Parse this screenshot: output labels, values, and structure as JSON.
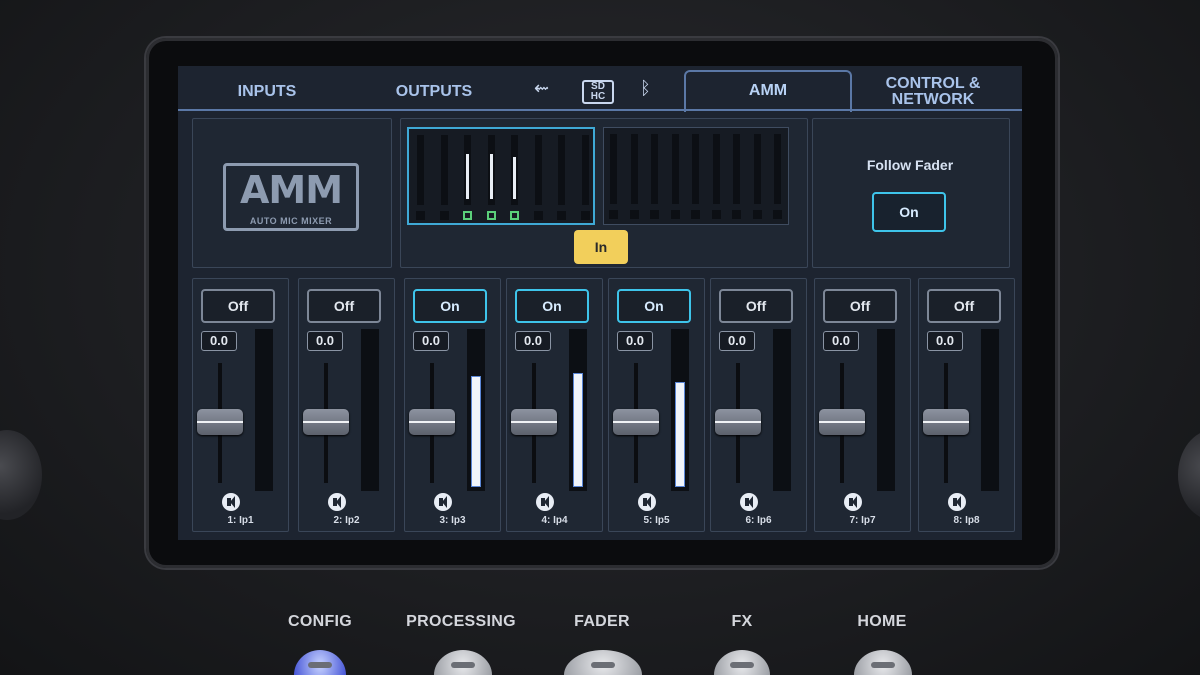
{
  "tabs": [
    {
      "label": "INPUTS",
      "active": false
    },
    {
      "label": "OUTPUTS",
      "active": false
    },
    {
      "label": "AMM",
      "active": true
    },
    {
      "label": "CONTROL & NETWORK",
      "active": false
    }
  ],
  "status_icons": [
    "usb-icon",
    "sd-card-icon",
    "bluetooth-icon"
  ],
  "sd_label": "SD HC",
  "amm_logo": {
    "word": "AMM",
    "sub": "AUTO MIC MIXER"
  },
  "meters": {
    "group1_levels": [
      0,
      0,
      0.75,
      0.75,
      0.7,
      0,
      0,
      0
    ],
    "group1_active_leds": [
      2,
      3,
      4
    ],
    "group2_levels": [
      0,
      0,
      0,
      0,
      0,
      0,
      0,
      0,
      0
    ]
  },
  "amm_in_button": "In",
  "follow_fader": {
    "label": "Follow Fader",
    "value": "On"
  },
  "channels": [
    {
      "state": "Off",
      "gain": "0.0",
      "name": "1: Ip1",
      "meter": 0
    },
    {
      "state": "Off",
      "gain": "0.0",
      "name": "2: Ip2",
      "meter": 0
    },
    {
      "state": "On",
      "gain": "0.0",
      "name": "3: Ip3",
      "meter": 0.72
    },
    {
      "state": "On",
      "gain": "0.0",
      "name": "4: Ip4",
      "meter": 0.74
    },
    {
      "state": "On",
      "gain": "0.0",
      "name": "5: Ip5",
      "meter": 0.68
    },
    {
      "state": "Off",
      "gain": "0.0",
      "name": "6: Ip6",
      "meter": 0
    },
    {
      "state": "Off",
      "gain": "0.0",
      "name": "7: Ip7",
      "meter": 0
    },
    {
      "state": "Off",
      "gain": "0.0",
      "name": "8: Ip8",
      "meter": 0
    }
  ],
  "hardware_buttons": [
    "CONFIG",
    "PROCESSING",
    "FADER",
    "FX",
    "HOME"
  ]
}
